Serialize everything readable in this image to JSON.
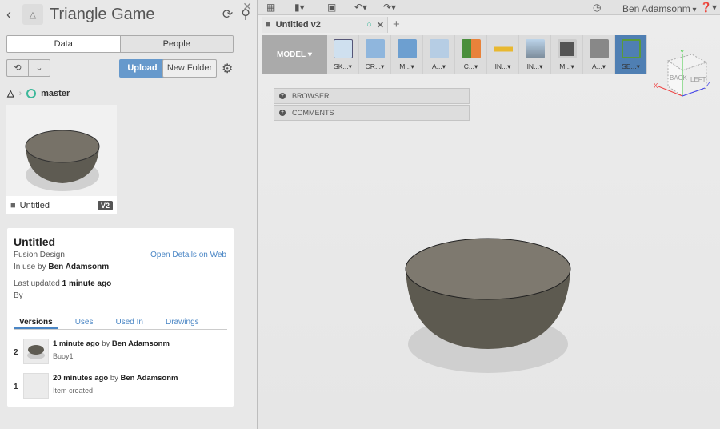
{
  "left": {
    "title": "Triangle Game",
    "seg": [
      "Data",
      "People"
    ],
    "upload": "Upload",
    "new_folder": "New Folder",
    "branch": "master",
    "thumb": {
      "name": "Untitled",
      "version": "V2"
    },
    "details": {
      "title": "Untitled",
      "type": "Fusion Design",
      "open_link": "Open Details on Web",
      "in_use_prefix": "In use by",
      "in_use_user": "Ben Adamsonm",
      "updated_prefix": "Last updated",
      "updated_value": "1 minute ago",
      "by": "By",
      "tabs": [
        "Versions",
        "Uses",
        "Used In",
        "Drawings"
      ],
      "versions": [
        {
          "num": "2",
          "when": "1 minute ago",
          "by": "by",
          "user": "Ben Adamsonm",
          "note": "Buoy1"
        },
        {
          "num": "1",
          "when": "20 minutes ago",
          "by": "by",
          "user": "Ben Adamsonm",
          "note": "Item created"
        }
      ]
    }
  },
  "top": {
    "user": "Ben Adamsonm",
    "help": "?"
  },
  "doc_tab": "Untitled v2",
  "toolbar": {
    "workspace": "MODEL",
    "tools": [
      "SK...",
      "CR...",
      "M...",
      "A...",
      "C...",
      "IN...",
      "IN...",
      "M...",
      "A...",
      "SE..."
    ]
  },
  "panels": [
    "BROWSER",
    "COMMENTS"
  ],
  "viewcube": {
    "back": "BACK",
    "left": "LEFT",
    "x": "X",
    "y": "Y",
    "z": "Z"
  }
}
